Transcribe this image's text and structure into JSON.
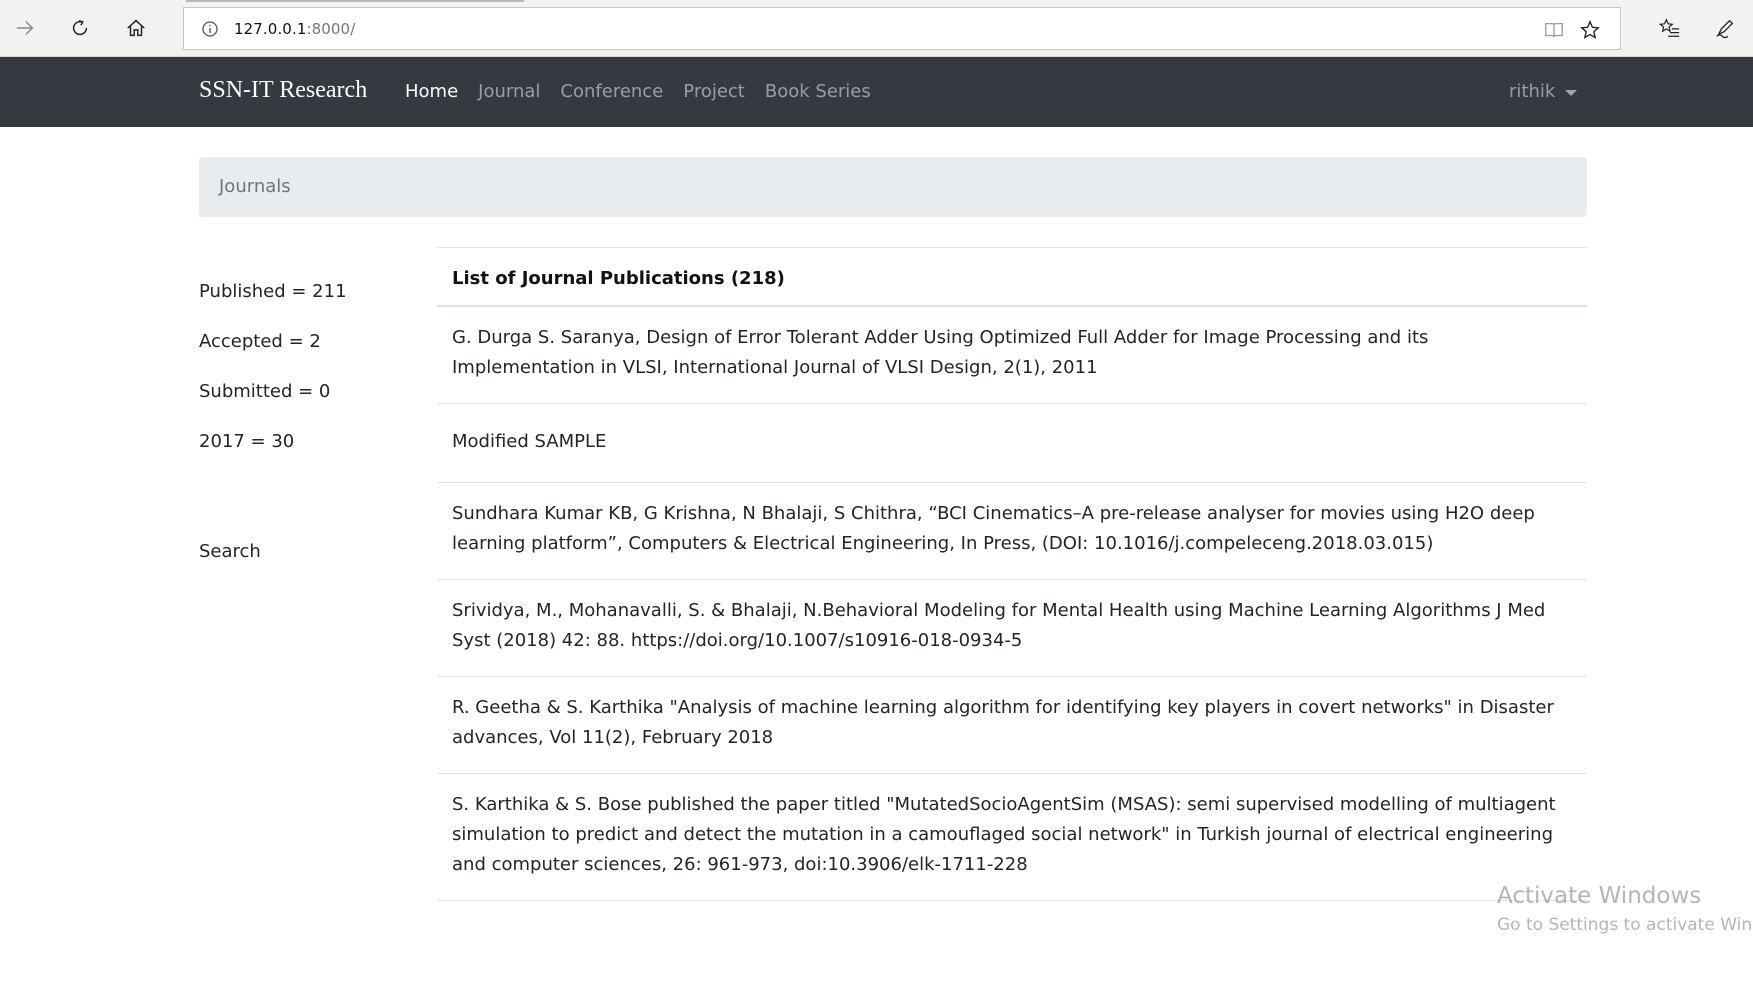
{
  "browser": {
    "url_host": "127.0.0.1",
    "url_port": ":8000/",
    "icons": [
      "forward-icon",
      "refresh-icon",
      "home-icon",
      "info-icon",
      "reading-view-icon",
      "favorite-star-icon",
      "favorites-list-icon",
      "pen-icon"
    ]
  },
  "navbar": {
    "brand": "SSN-IT Research",
    "links": [
      {
        "label": "Home",
        "active": true
      },
      {
        "label": "Journal",
        "active": false
      },
      {
        "label": "Conference",
        "active": false
      },
      {
        "label": "Project",
        "active": false
      },
      {
        "label": "Book Series",
        "active": false
      }
    ],
    "user": "rithik",
    "background": "#343a40"
  },
  "breadcrumb": {
    "label": "Journals"
  },
  "sidebar": {
    "stats": [
      "Published = 211",
      "Accepted = 2",
      "Submitted = 0",
      "2017 = 30"
    ],
    "search_label": "Search"
  },
  "publications": {
    "header": "List of Journal Publications (218)",
    "items": [
      "G. Durga S. Saranya, Design of Error Tolerant Adder Using Optimized Full Adder for Image Processing and its Implementation in VLSI, International Journal of VLSI Design, 2(1), 2011",
      "Modified SAMPLE",
      "Sundhara Kumar KB, G Krishna, N Bhalaji, S Chithra, “BCI Cinematics–A pre-release analyser for movies using H2O deep learning platform”, Computers & Electrical Engineering, In Press, (DOI: 10.1016/j.compeleceng.2018.03.015)",
      "Srividya, M., Mohanavalli, S. & Bhalaji, N.Behavioral Modeling for Mental Health using Machine Learning Algorithms J Med Syst (2018) 42: 88. https://doi.org/10.1007/s10916-018-0934-5",
      "R. Geetha & S. Karthika \"Analysis of machine learning algorithm for identifying key players in covert networks\" in Disaster advances, Vol 11(2), February 2018",
      "S. Karthika & S. Bose published the paper titled \"MutatedSocioAgentSim (MSAS): semi supervised modelling of multiagent simulation to predict and detect the mutation in a camouflaged social network\" in Turkish journal of electrical engineering and computer sciences, 26: 961-973, doi:10.3906/elk-1711-228"
    ]
  },
  "watermark": {
    "line1": "Activate Windows",
    "line2": "Go to Settings to activate Windows."
  }
}
